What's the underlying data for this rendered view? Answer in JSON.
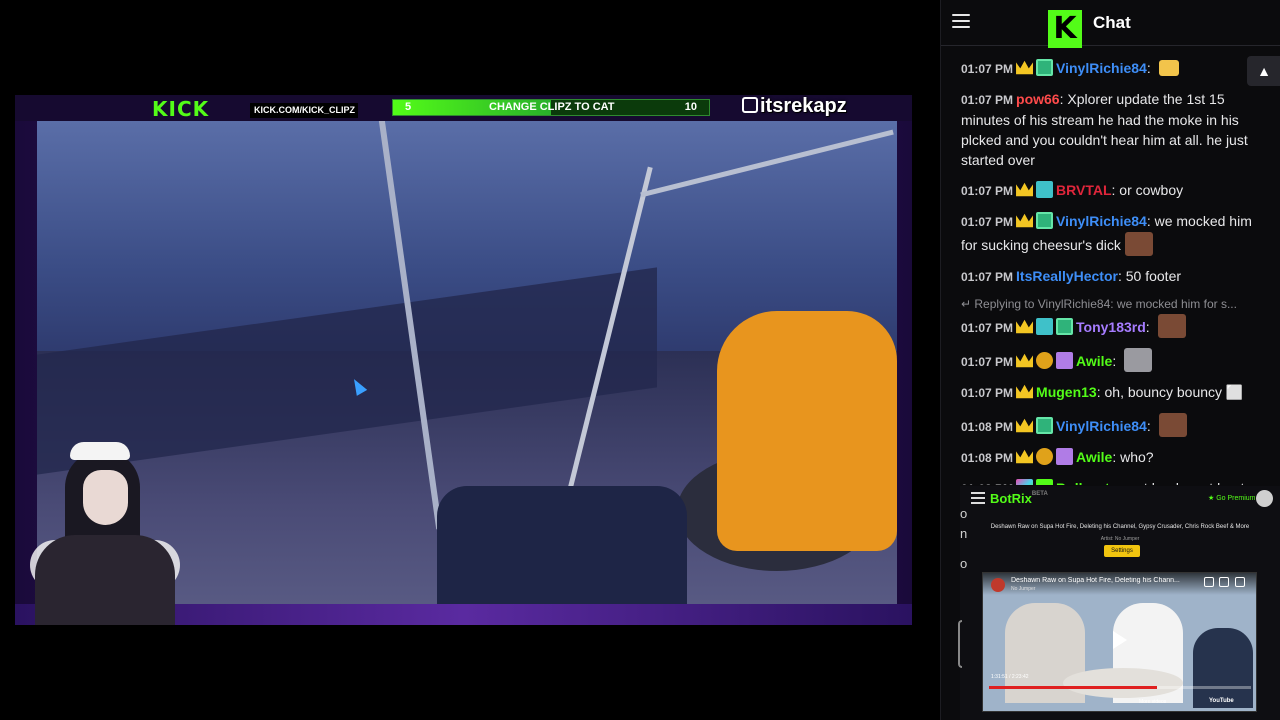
{
  "stream": {
    "overlay": {
      "kick_logo": "KICK",
      "kick_url": "KICK.COM/KICK_CLIPZ",
      "goal": {
        "start": "5",
        "label": "CHANGE CLIPZ TO CAT",
        "end": "10",
        "progress": 0.5
      },
      "handle": "itsrekapz"
    }
  },
  "chat": {
    "title": "Chat",
    "logo": "K",
    "pin_icon": "pin-icon",
    "messages": [
      {
        "time": "01:07 PM",
        "badges": [
          "crown",
          "green"
        ],
        "user": "VinylRichie84",
        "color": "#3e8ef7",
        "text": "",
        "emote": "folder"
      },
      {
        "time": "01:07 PM",
        "badges": [],
        "user": "pow66",
        "color": "#ff4b4b",
        "text": "Xplorer update the 1st 15 minutes of his stream he had the moke in his plcked and you couldn't hear him at all. he just started over",
        "emote": ""
      },
      {
        "time": "01:07 PM",
        "badges": [
          "crown",
          "og"
        ],
        "user": "BRVTAL",
        "color": "#e0263b",
        "text": "or cowboy",
        "emote": ""
      },
      {
        "time": "01:07 PM",
        "badges": [
          "crown",
          "green"
        ],
        "user": "VinylRichie84",
        "color": "#3e8ef7",
        "text": "we mocked him for sucking cheesur's dick",
        "emote": "face"
      },
      {
        "time": "01:07 PM",
        "badges": [],
        "user": "ItsReallyHector",
        "color": "#3e8ef7",
        "text": "50 footer",
        "emote": ""
      },
      {
        "reply": "Replying to VinylRichie84: we mocked him for s..."
      },
      {
        "time": "01:07 PM",
        "badges": [
          "crown",
          "og",
          "green"
        ],
        "user": "Tony183rd",
        "color": "#a67cff",
        "text": "",
        "emote": "face"
      },
      {
        "time": "01:07 PM",
        "badges": [
          "crown",
          "coin",
          "gift"
        ],
        "user": "Awile",
        "color": "#53fc18",
        "text": "",
        "emote": "grey"
      },
      {
        "time": "01:07 PM",
        "badges": [
          "crown"
        ],
        "user": "Mugen13",
        "color": "#53fc18",
        "text": "oh, bouncy bouncy ⬜",
        "emote": ""
      },
      {
        "time": "01:08 PM",
        "badges": [
          "crown",
          "green"
        ],
        "user": "VinylRichie84",
        "color": "#3e8ef7",
        "text": "",
        "emote": "face"
      },
      {
        "time": "01:08 PM",
        "badges": [
          "crown",
          "coin",
          "gift"
        ],
        "user": "Awile",
        "color": "#53fc18",
        "text": "who?",
        "emote": ""
      },
      {
        "time": "01:08 PM",
        "badges": [
          "rainbow",
          "giftg"
        ],
        "user": "Bullrout",
        "color": "#53fc18",
        "text": "must be decent boat or he'd drown",
        "emote": ""
      }
    ]
  },
  "botrix": {
    "title": "BotRix",
    "title_sup": "BETA",
    "premium": "★ Go Premium",
    "video_title": "Deshawn Raw on Supa Hot Fire, Deleting his Channel, Gypsy Crusader, Chris Rock Beef & More",
    "artist": "Artist: No Jumper",
    "settings": "Settings",
    "player": {
      "title": "Deshawn Raw on Supa Hot Fire, Deleting his Chann...",
      "channel": "No Jumper",
      "time": "1:31:51 / 2:23:42",
      "progress": 0.64,
      "more_videos": "More videos",
      "youtube": "YouTube"
    },
    "side_letters": [
      "o",
      "n",
      "o"
    ]
  }
}
